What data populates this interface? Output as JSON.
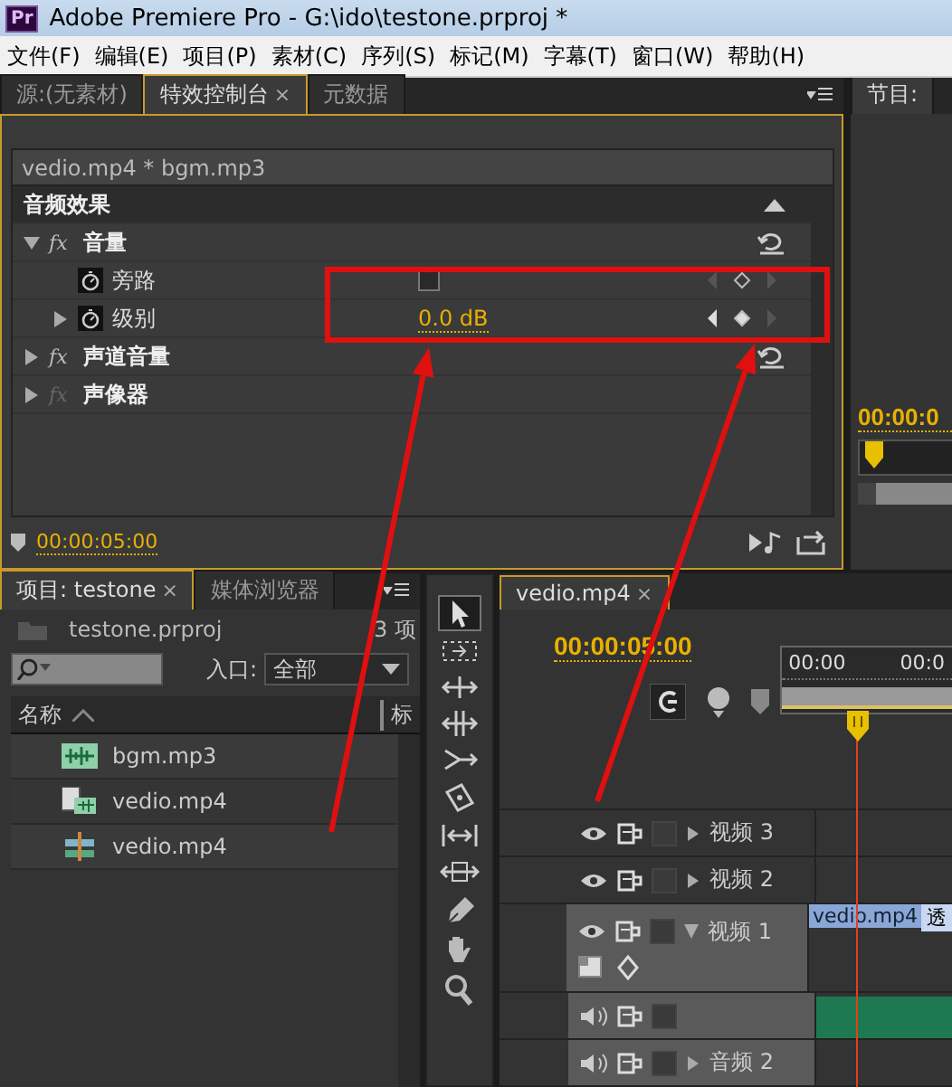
{
  "window": {
    "badge": "Pr",
    "title": "Adobe Premiere Pro - G:\\ido\\testone.prproj *"
  },
  "menu": [
    "文件(F)",
    "编辑(E)",
    "项目(P)",
    "素材(C)",
    "序列(S)",
    "标记(M)",
    "字幕(T)",
    "窗口(W)",
    "帮助(H)"
  ],
  "effect_panel": {
    "tabs": [
      {
        "label": "源:(无素材)",
        "selected": false
      },
      {
        "label": "特效控制台",
        "selected": true,
        "close": "×"
      },
      {
        "label": "元数据",
        "selected": false
      }
    ],
    "clip": "vedio.mp4 * bgm.mp3",
    "section": "音频效果",
    "effects": [
      {
        "icon": "fx",
        "name": "音量",
        "expanded": true,
        "fx_enabled": true,
        "params": [
          {
            "name": "旁路",
            "kind": "checkbox",
            "checked": false
          },
          {
            "name": "级别",
            "kind": "value",
            "value": "0.0 dB",
            "expanded": false
          }
        ]
      },
      {
        "icon": "fx",
        "name": "声道音量",
        "expanded": false,
        "fx_enabled": true
      },
      {
        "icon": "fx",
        "name": "声像器",
        "expanded": false,
        "fx_enabled": false
      }
    ],
    "timecode": "00:00:05:00"
  },
  "program_panel": {
    "tab": "节目:",
    "timecode": "00:00:0"
  },
  "project_panel": {
    "tabs": [
      {
        "label": "项目: testone",
        "selected": true,
        "close": "×"
      },
      {
        "label": "媒体浏览器",
        "selected": false
      }
    ],
    "file": "testone.prproj",
    "count": "3 项",
    "entry_label": "入口:",
    "entry_value": "全部",
    "columns": [
      "名称",
      "标"
    ],
    "items": [
      {
        "name": "bgm.mp3",
        "kind": "audio"
      },
      {
        "name": "vedio.mp4",
        "kind": "video"
      },
      {
        "name": "vedio.mp4",
        "kind": "sequence"
      }
    ]
  },
  "timeline": {
    "tab": "vedio.mp4",
    "close": "×",
    "timecode": "00:00:05:00",
    "ruler": [
      "00:00",
      "00:0"
    ],
    "tracks": [
      {
        "kind": "video",
        "label": "视频 3",
        "expanded": false
      },
      {
        "kind": "video",
        "label": "视频 2",
        "expanded": false
      },
      {
        "kind": "video",
        "label": "视频 1",
        "expanded": true,
        "clips": [
          "vedio.mp4",
          "透"
        ]
      },
      {
        "kind": "audio",
        "audio_clip": true
      },
      {
        "kind": "audio",
        "label": "音频 2",
        "expanded": false
      }
    ]
  }
}
